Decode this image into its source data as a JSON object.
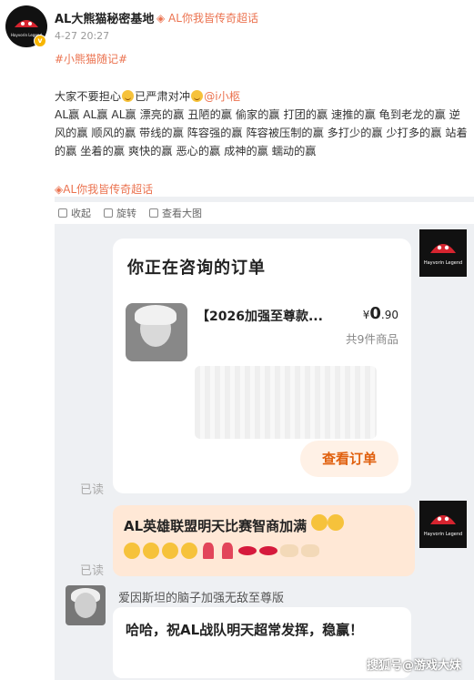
{
  "post": {
    "author": "AL大熊猫秘密基地",
    "super_chat": "AL你我皆传奇超话",
    "time": "4-27 20:27",
    "topic": "#小熊猫随记#",
    "line1_a": "大家不要担心",
    "line1_b": "已严肃对冲",
    "mention": "@i小柩",
    "line2": "AL赢 AL赢 AL赢 漂亮的赢 丑陋的赢 偷家的赢 打团的赢 速推的赢 龟到老龙的赢 逆风的赢 顺风的赢 带线的赢 阵容强的赢 阵容被压制的赢 多打少的赢 少打多的赢 站着的赢 坐着的赢 爽快的赢 恶心的赢 成神的赢 蠕动的赢",
    "super_chat_footer": "AL你我皆传奇超话",
    "avatar_text": "Hayvorin Legend"
  },
  "image_tools": {
    "zoom_out": "收起",
    "rotate": "旋转",
    "view_large": "查看大图"
  },
  "chat": {
    "card_title": "你正在咨询的订单",
    "product_name": "【2026加强至尊款...",
    "price_symbol": "¥",
    "price_int": "0",
    "price_dec": ".90",
    "item_count": "共9件商品",
    "view_order": "查看订单",
    "read_label_1": "已读",
    "read_label_2": "已读",
    "shop_avatar_text": "Hayvorin Legend",
    "orange_msg": "AL英雄联盟明天比赛智商加满",
    "user_name": "爱因斯坦的脑子加强无敌至尊版",
    "white_msg": "哈哈，祝AL战队明天超常发挥，稳赢！"
  },
  "watermark": "搜狐号@游戏大妹",
  "colors": {
    "accent": "#eb7350",
    "orange_bubble": "#ffe8d6",
    "button_text": "#e0600e"
  }
}
